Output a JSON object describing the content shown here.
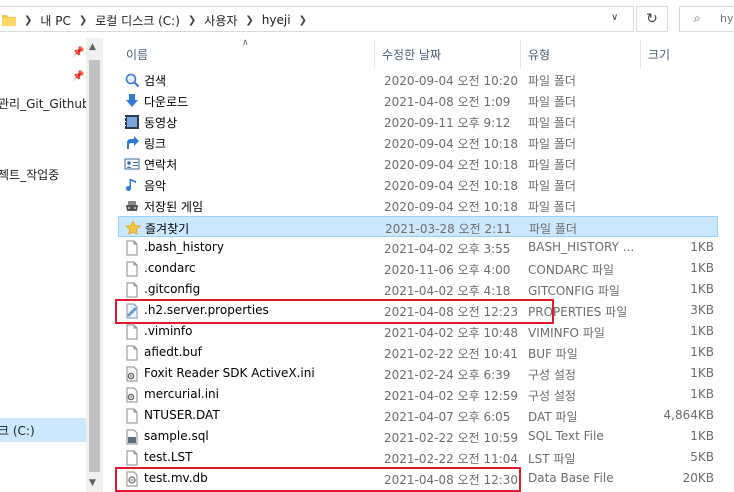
{
  "address": {
    "crumbs": [
      "내 PC",
      "로컬 디스크 (C:)",
      "사용자",
      "hyeji"
    ],
    "search_placeholder": "hye"
  },
  "nav": {
    "items": [
      {
        "label": "관리_Git_Github"
      },
      {
        "label": "젝트_작업중"
      },
      {
        "label": "크 (C:)"
      }
    ]
  },
  "columns": {
    "name": "이름",
    "date": "수정한 날짜",
    "type": "유형",
    "size": "크기"
  },
  "files": [
    {
      "name": "검색",
      "date": "2020-09-04 오전 10:20",
      "type": "파일 폴더",
      "size": "",
      "icon": "search-folder-icon"
    },
    {
      "name": "다운로드",
      "date": "2021-04-08 오전 1:09",
      "type": "파일 폴더",
      "size": "",
      "icon": "download-folder-icon"
    },
    {
      "name": "동영상",
      "date": "2020-09-11 오후 9:12",
      "type": "파일 폴더",
      "size": "",
      "icon": "video-folder-icon"
    },
    {
      "name": "링크",
      "date": "2020-09-04 오전 10:18",
      "type": "파일 폴더",
      "size": "",
      "icon": "links-folder-icon"
    },
    {
      "name": "연락처",
      "date": "2020-09-04 오전 10:18",
      "type": "파일 폴더",
      "size": "",
      "icon": "contacts-folder-icon"
    },
    {
      "name": "음악",
      "date": "2020-09-04 오전 10:18",
      "type": "파일 폴더",
      "size": "",
      "icon": "music-folder-icon"
    },
    {
      "name": "저장된 게임",
      "date": "2020-09-04 오전 10:18",
      "type": "파일 폴더",
      "size": "",
      "icon": "saved-games-folder-icon"
    },
    {
      "name": "즐겨찾기",
      "date": "2021-03-28 오전 2:11",
      "type": "파일 폴더",
      "size": "",
      "icon": "favorites-folder-icon"
    },
    {
      "name": ".bash_history",
      "date": "2021-04-02 오후 3:55",
      "type": "BASH_HISTORY ...",
      "size": "1KB",
      "icon": "file-icon"
    },
    {
      "name": ".condarc",
      "date": "2020-11-06 오후 4:00",
      "type": "CONDARC 파일",
      "size": "1KB",
      "icon": "file-icon"
    },
    {
      "name": ".gitconfig",
      "date": "2021-04-02 오후 4:18",
      "type": "GITCONFIG 파일",
      "size": "1KB",
      "icon": "file-icon"
    },
    {
      "name": ".h2.server.properties",
      "date": "2021-04-08 오전 12:23",
      "type": "PROPERTIES 파일",
      "size": "3KB",
      "icon": "properties-file-icon"
    },
    {
      "name": ".viminfo",
      "date": "2021-04-02 오후 10:48",
      "type": "VIMINFO 파일",
      "size": "1KB",
      "icon": "file-icon"
    },
    {
      "name": "afiedt.buf",
      "date": "2021-02-22 오전 10:41",
      "type": "BUF 파일",
      "size": "1KB",
      "icon": "file-icon"
    },
    {
      "name": "Foxit Reader SDK ActiveX.ini",
      "date": "2021-02-24 오후 6:39",
      "type": "구성 설정",
      "size": "1KB",
      "icon": "settings-file-icon"
    },
    {
      "name": "mercurial.ini",
      "date": "2021-04-02 오후 12:59",
      "type": "구성 설정",
      "size": "1KB",
      "icon": "settings-file-icon"
    },
    {
      "name": "NTUSER.DAT",
      "date": "2021-04-07 오후 6:05",
      "type": "DAT 파일",
      "size": "4,864KB",
      "icon": "file-icon"
    },
    {
      "name": "sample.sql",
      "date": "2021-02-22 오전 10:59",
      "type": "SQL Text File",
      "size": "1KB",
      "icon": "sql-file-icon"
    },
    {
      "name": "test.LST",
      "date": "2021-02-22 오전 11:04",
      "type": "LST 파일",
      "size": "5KB",
      "icon": "file-icon"
    },
    {
      "name": "test.mv.db",
      "date": "2021-04-08 오전 12:30",
      "type": "Data Base File",
      "size": "20KB",
      "icon": "database-file-icon"
    }
  ],
  "colors": {
    "selection": "#cce8ff",
    "highlight": "#e21a2c",
    "header_text": "#4c607a"
  }
}
